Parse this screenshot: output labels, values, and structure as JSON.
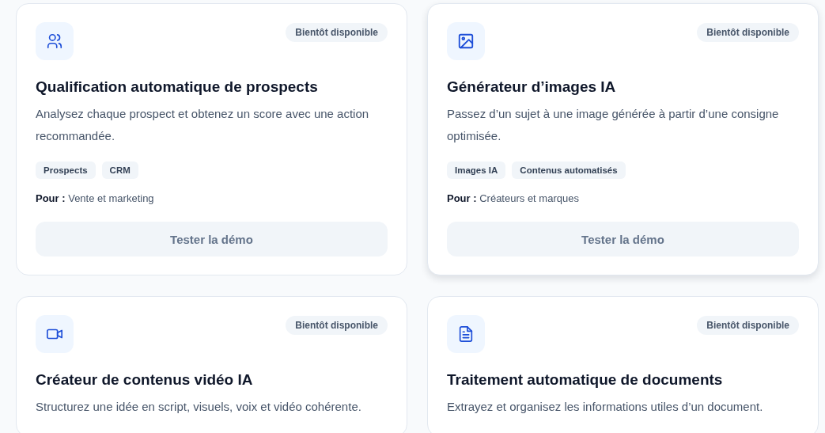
{
  "cards": [
    {
      "kind": "users",
      "badge": "Bientôt disponible",
      "title": "Qualification automatique de prospects",
      "description": "Analysez chaque prospect et obtenez un score avec une action recommandée.",
      "tags": [
        "Prospects",
        "CRM"
      ],
      "audience_label": "Pour :",
      "audience": "Vente et marketing",
      "button": "Tester la démo",
      "highlighted": false
    },
    {
      "kind": "image",
      "badge": "Bientôt disponible",
      "title": "Générateur d’images IA",
      "description": "Passez d’un sujet à une image générée à partir d’une consigne optimisée.",
      "tags": [
        "Images IA",
        "Contenus automatisés"
      ],
      "audience_label": "Pour :",
      "audience": "Créateurs et marques",
      "button": "Tester la démo",
      "highlighted": true
    },
    {
      "kind": "video",
      "badge": "Bientôt disponible",
      "title": "Créateur de contenus vidéo IA",
      "description": "Structurez une idée en script, visuels, voix et vidéo cohérente.",
      "highlighted": false
    },
    {
      "kind": "document",
      "badge": "Bientôt disponible",
      "title": "Traitement automatique de documents",
      "description": "Extrayez et organisez les informations utiles d’un document.",
      "highlighted": false
    }
  ]
}
